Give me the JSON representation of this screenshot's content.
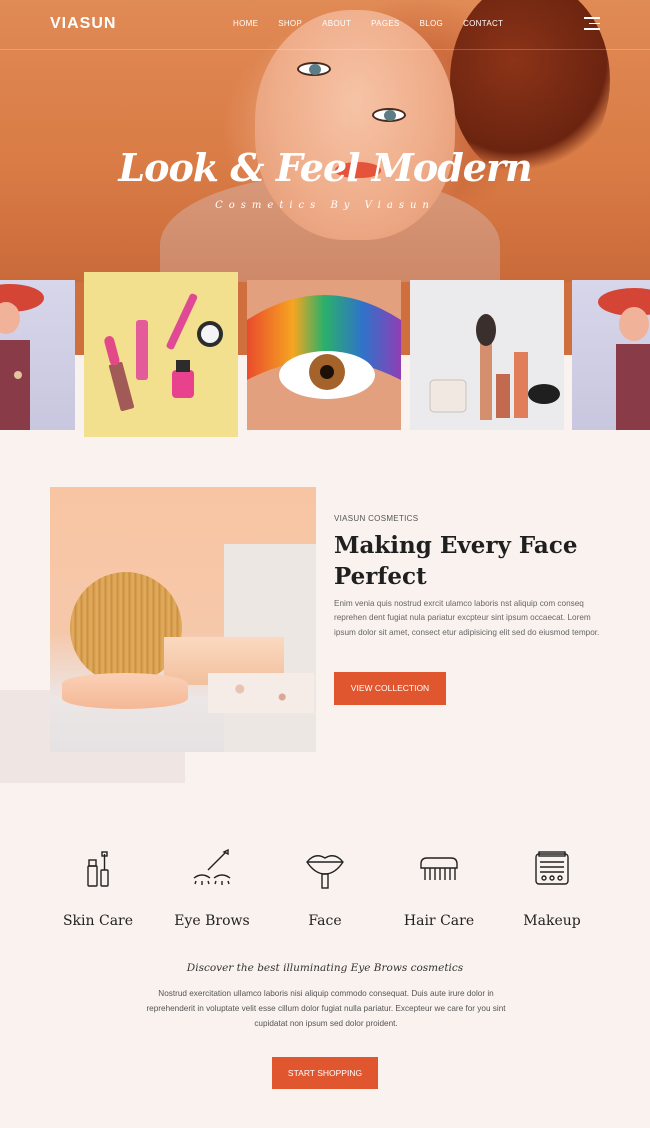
{
  "brand": {
    "name": "VIASUN"
  },
  "nav": {
    "items": [
      "HOME",
      "SHOP",
      "ABOUT",
      "PAGES",
      "BLOG",
      "CONTACT"
    ]
  },
  "hero": {
    "title": "Look & Feel Modern",
    "subtitle": "Cosmetics By Viasun"
  },
  "about": {
    "kicker": "VIASUN COSMETICS",
    "title": "Making Every Face Perfect",
    "text": "Enim venia quis nostrud exrcit ulamco laboris nst aliquip com conseq reprehen dent fugiat nula pariatur excpteur sint ipsum occaecat. Lorem ipsum dolor sit amet, consect etur adipisicing elit sed do eiusmod tempor.",
    "button": "VIEW COLLECTION"
  },
  "categories": [
    {
      "label": "Skin Care",
      "icon": "skin-care-bottle-icon"
    },
    {
      "label": "Eye Brows",
      "icon": "eye-brows-icon"
    },
    {
      "label": "Face",
      "icon": "lips-brush-icon"
    },
    {
      "label": "Hair Care",
      "icon": "comb-icon"
    },
    {
      "label": "Makeup",
      "icon": "palette-icon"
    }
  ],
  "discover": {
    "title": "Discover the best illuminating Eye Brows cosmetics",
    "text": "Nostrud exercitation ullamco laboris nisi aliquip commodo consequat. Duis aute irure dolor in reprehenderit in voluptate velit esse cillum dolor fugiat nulla pariatur. Excepteur we care for you sint cupidatat non ipsum sed dolor proident.",
    "button": "START SHOPPING"
  },
  "colors": {
    "accent": "#e0562f",
    "background": "#f9f2ef",
    "hero": "#d97b45"
  }
}
